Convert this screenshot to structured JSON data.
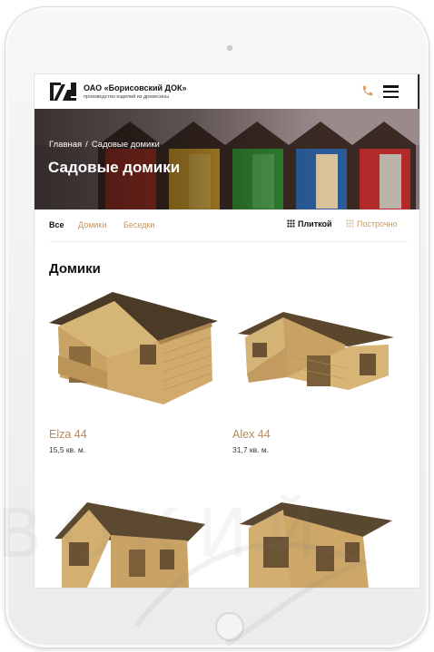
{
  "header": {
    "company_name": "ОАО «Борисовский ДОК»",
    "company_tagline": "производство изделий из древесины"
  },
  "hero": {
    "breadcrumb": [
      "Главная",
      "Садовые домики"
    ],
    "breadcrumb_separator": "/",
    "title": "Садовые домики"
  },
  "filters": {
    "tabs": [
      "Все",
      "Домики",
      "Беседки"
    ],
    "active_tab": "Все",
    "views": [
      "Плиткой",
      "Построчно"
    ],
    "active_view": "Плиткой"
  },
  "section": {
    "title": "Домики"
  },
  "products": [
    {
      "name": "Elza 44",
      "area": "15,5 кв. м."
    },
    {
      "name": "Alex 44",
      "area": "31,7 кв. м."
    },
    {
      "name": "",
      "area": ""
    },
    {
      "name": "",
      "area": ""
    }
  ],
  "watermark": {
    "text": "ВОКИЙ"
  },
  "colors": {
    "accent": "#c59763",
    "product_name": "#b58a5e",
    "text": "#111111"
  },
  "icons": [
    "logo-icon",
    "phone-icon",
    "menu-icon",
    "grid-view-icon",
    "list-view-icon"
  ]
}
